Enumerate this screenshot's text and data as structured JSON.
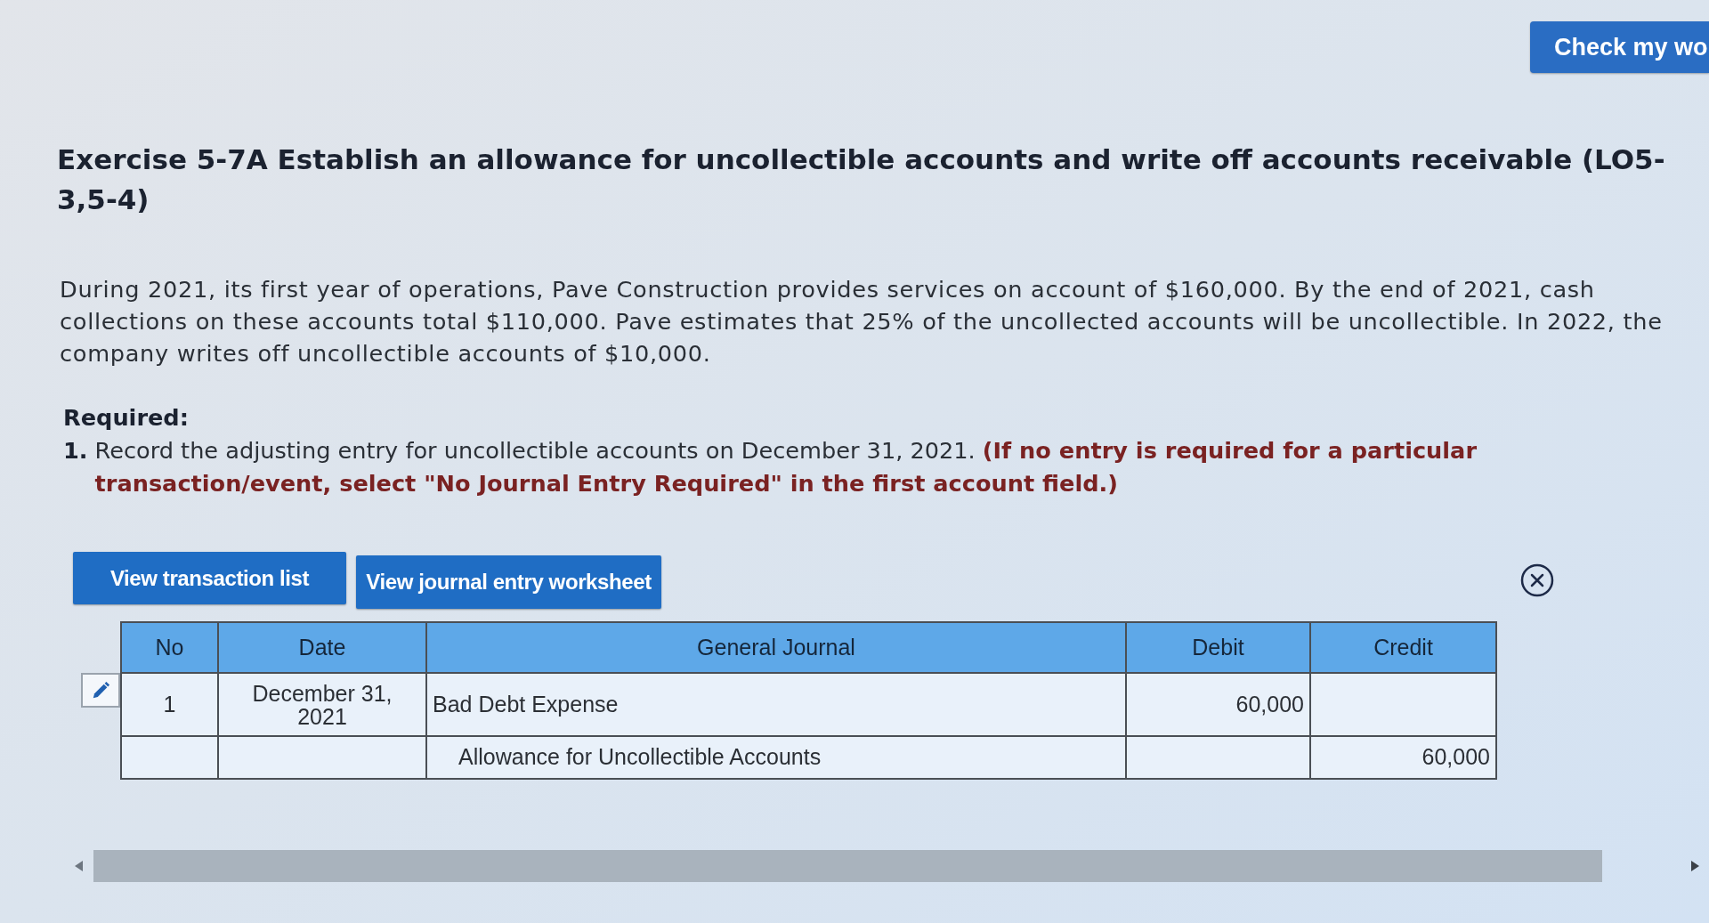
{
  "check_button": {
    "label": "Check my wo"
  },
  "exercise": {
    "title": "Exercise 5-7A Establish an allowance for uncollectible accounts and write off accounts receivable (LO5-3,5-4)",
    "description": "During 2021, its first year of operations, Pave Construction provides services on account of $160,000. By the end of 2021, cash collections on these accounts total $110,000. Pave estimates that 25% of the uncollected accounts will be uncollectible. In 2022, the company writes off uncollectible accounts of $10,000.",
    "required_label": "Required:",
    "steps": [
      {
        "number": "1.",
        "text": "Record the adjusting entry for uncollectible accounts on December 31, 2021. **(If no entry is required for a particular transaction/event, select \"No Journal Entry Required\" in the first account field.)**"
      }
    ]
  },
  "actions": [
    {
      "label": "View transaction list"
    },
    {
      "label": "View journal entry worksheet"
    }
  ],
  "journal": {
    "columns": [
      "No",
      "Date",
      "General Journal",
      "Debit",
      "Credit"
    ],
    "rows": [
      {
        "editable": true,
        "kind": "debit",
        "no": "1",
        "date": "December 31, 2021",
        "account": "Bad Debt Expense",
        "debit": "60,000"
      },
      {
        "editable": false,
        "kind": "credit",
        "account": "Allowance for Uncollectible Accounts",
        "credit": "60,000"
      }
    ]
  }
}
